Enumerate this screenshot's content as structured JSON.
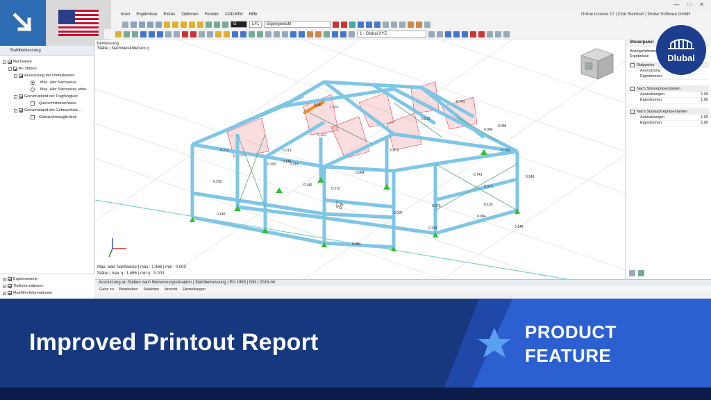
{
  "menu": {
    "items": [
      "hnen",
      "Ergebnisse",
      "Extras",
      "Optionen",
      "Fenster",
      "CAD-BIM",
      "Hilfe"
    ],
    "license": "Online License 17 | Cloé Steinhart | Dlubal Software GmbH"
  },
  "toolbar": {
    "loadcase_code": "G",
    "loadcase_id": "LF1",
    "loadcase_name": "Eigengewicht",
    "coord_system": "1 - Global XYZ"
  },
  "navigator": {
    "title": "Stahlbemessung",
    "tree": [
      {
        "label": "Nachweise"
      },
      {
        "label": "An Stäben"
      },
      {
        "label": "Ausnutzung der Umhüllenden"
      },
      {
        "label": "Max. aller Nachweise"
      },
      {
        "label": "Max. aller Nachweise ohne..."
      },
      {
        "label": "Grenzzustand der Tragfähigkeit"
      },
      {
        "label": "Querschnittsnachweis"
      },
      {
        "label": "Grenzzustand der Gebrauchsta..."
      },
      {
        "label": "Gebrauchstauglichkeit"
      }
    ],
    "bottom_items": [
      "Ergebniswerte",
      "Titelinformationen",
      "Max/Min-Informationen"
    ]
  },
  "viewport": {
    "title_line1": "bemessung",
    "title_line2": "Stäbe | Nachweiskriterium η",
    "status_line1": "Max. aller Nachweise | max : 1.466 | min : 0.003",
    "status_line2": "Stäbe | max η : 1.466 | min η : 0.003",
    "labels": [
      "0.047",
      "0.272",
      "0.146",
      "0.146",
      "0.084",
      "0.741",
      "0.313",
      "0.084",
      "0.072",
      "0.133",
      "0.007",
      "0.084",
      "0.084",
      "0.146",
      "0.146",
      "0.313",
      "0.741",
      "0.133",
      "0.292",
      "0.292",
      "0.272",
      "0.313",
      "1.466",
      "0.462",
      "0.084",
      "0.146",
      "0.741",
      "0.272",
      "0.072"
    ]
  },
  "control_panel": {
    "title": "Steuerpanel",
    "subtitle1": "Anzeigefaktoren",
    "subtitle2": "Ergebnisse",
    "sections": [
      {
        "name": "Stabweise",
        "rows": [
          {
            "label": "Ausnutzung",
            "value": ""
          },
          {
            "label": "Eigenformen",
            "value": ""
          }
        ]
      },
      {
        "name": "Nach Stabrepräsentanten",
        "rows": [
          {
            "label": "Ausnutzungen",
            "value": "1.00"
          },
          {
            "label": "Eigenformen",
            "value": "1.00"
          }
        ]
      },
      {
        "name": "Nach Stabsatzrepräsentanten",
        "rows": [
          {
            "label": "Ausnutzungen",
            "value": "1.00"
          },
          {
            "label": "Eigenformen",
            "value": "1.00"
          }
        ]
      }
    ]
  },
  "results": {
    "header": "Ausnutzung an Stäben nach Bemessungssituation | Stahlbemessung | EN 1993 | DIN | 2016-04",
    "menu": [
      "Gehe zu",
      "Bearbeiten",
      "Selektion",
      "Ansicht",
      "Einstellungen"
    ]
  },
  "brand": {
    "logo_text": "Dlubal"
  },
  "banner": {
    "title": "Improved Printout Report",
    "tag_line1": "PRODUCT",
    "tag_line2": "FEATURE"
  },
  "colors": {
    "banner_blue": "#17387e",
    "banner_light": "#2c5fcf",
    "star": "#5aa0f0",
    "member": "#7fc6e6",
    "support": "#2fbf2f",
    "diagram": "#e04050"
  }
}
